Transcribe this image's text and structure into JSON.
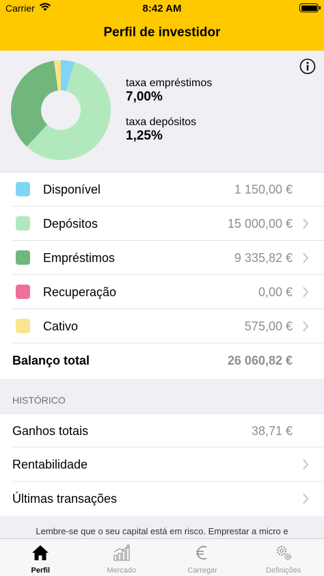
{
  "status": {
    "carrier": "Carrier",
    "time": "8:42 AM"
  },
  "nav": {
    "title": "Perfil de investidor"
  },
  "portfolio": {
    "loan_rate_label": "taxa empréstimos",
    "loan_rate_value": "7,00%",
    "deposit_rate_label": "taxa depósitos",
    "deposit_rate_value": "1,25%",
    "items": [
      {
        "label": "Disponível",
        "value": "1 150,00 €",
        "color": "#80d4f4",
        "amount": 1150.0,
        "chevron": false
      },
      {
        "label": "Depósitos",
        "value": "15 000,00 €",
        "color": "#b1e9bd",
        "amount": 15000.0,
        "chevron": true
      },
      {
        "label": "Empréstimos",
        "value": "9 335,82 €",
        "color": "#71b67c",
        "amount": 9335.82,
        "chevron": true
      },
      {
        "label": "Recuperação",
        "value": "0,00 €",
        "color": "#ee7199",
        "amount": 0.0,
        "chevron": true
      },
      {
        "label": "Cativo",
        "value": "575,00 €",
        "color": "#fbe48b",
        "amount": 575.0,
        "chevron": true
      }
    ],
    "total_label": "Balanço total",
    "total_value": "26 060,82 €"
  },
  "history": {
    "header": "HISTÓRICO",
    "rows": [
      {
        "label": "Ganhos totais",
        "value": "38,71 €"
      },
      {
        "label": "Rentabilidade",
        "value": ""
      },
      {
        "label": "Últimas transações",
        "value": ""
      }
    ]
  },
  "footer_note": "Lembre-se que o seu capital está em risco. Emprestar a micro e",
  "tabs": [
    {
      "label": "Perfil",
      "icon": "home-icon",
      "active": true
    },
    {
      "label": "Mercado",
      "icon": "market-chart-icon",
      "active": false
    },
    {
      "label": "Carregar",
      "icon": "euro-icon",
      "active": false
    },
    {
      "label": "Definições",
      "icon": "settings-gears-icon",
      "active": false
    }
  ],
  "colors": {
    "accent": "#ffc900",
    "secondary_text": "#8e8e93"
  }
}
